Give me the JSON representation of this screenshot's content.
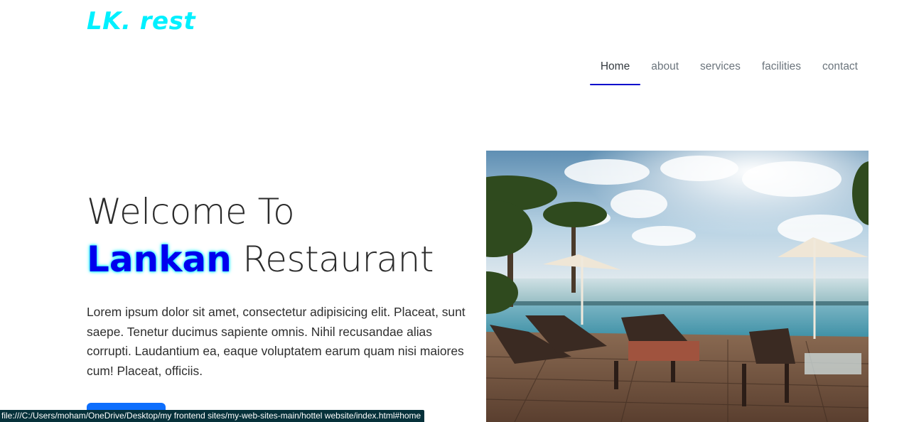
{
  "header": {
    "brand": "LK. rest",
    "nav": [
      {
        "label": "Home",
        "active": true
      },
      {
        "label": "about",
        "active": false
      },
      {
        "label": "services",
        "active": false
      },
      {
        "label": "facilities",
        "active": false
      },
      {
        "label": "contact",
        "active": false
      }
    ]
  },
  "hero": {
    "title_line1": "Welcome To",
    "title_accent": "Lankan",
    "title_rest": "Restaurant",
    "paragraph": "Lorem ipsum dolor sit amet, consectetur adipisicing elit. Placeat, sunt saepe. Tenetur ducimus sapiente omnis. Nihil recusandae alias corrupti. Laudantium ea, eaque voluptatem earum quam nisi maiores cum! Placeat, officiis.",
    "image_alt": "beach-resort-pool-photo"
  },
  "status_bar": {
    "url": "file:///C:/Users/moham/OneDrive/Desktop/my frontend sites/my-web-sites-main/hottel website/index.html#home"
  },
  "colors": {
    "brand": "#00f0ff",
    "accent": "#0000ee",
    "nav_underline": "#0000cc",
    "button": "#0d6efd",
    "status_bg": "#06313a"
  }
}
